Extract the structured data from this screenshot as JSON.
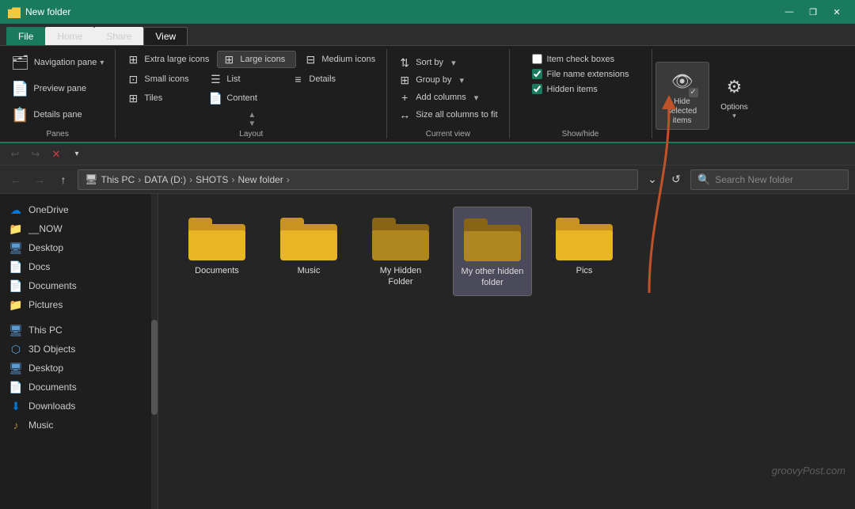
{
  "titlebar": {
    "title": "New folder",
    "min": "—",
    "restore": "❐",
    "close": "✕"
  },
  "tabs": {
    "file": "File",
    "home": "Home",
    "share": "Share",
    "view": "View"
  },
  "ribbon": {
    "panes": {
      "label": "Panes",
      "navigation": "Navigation pane",
      "preview": "Preview pane",
      "details": "Details pane"
    },
    "layout": {
      "label": "Layout",
      "extra_large": "Extra large icons",
      "large": "Large icons",
      "medium": "Medium icons",
      "small": "Small icons",
      "list": "List",
      "details": "Details",
      "tiles": "Tiles",
      "content": "Content"
    },
    "current_view": {
      "label": "Current view",
      "sort": "Sort by",
      "group": "Group by",
      "add_columns": "Add columns",
      "size_columns": "Size all columns to fit"
    },
    "show_hide": {
      "label": "Show/hide",
      "item_checkboxes": "Item check boxes",
      "file_extensions": "File name extensions",
      "hidden_items": "Hidden items",
      "hide_selected": "Hide selected items",
      "options": "Options"
    }
  },
  "quickaccess": {
    "undo": "↩",
    "redo": "↪",
    "delete": "✕",
    "dropdown": "▾"
  },
  "addressbar": {
    "back": "←",
    "forward": "→",
    "up": "↑",
    "path": {
      "thispc": "This PC",
      "sep1": ">",
      "data": "DATA (D:)",
      "sep2": ">",
      "shots": "SHOTS",
      "sep3": ">",
      "folder": "New folder",
      "sep4": ">"
    },
    "search_placeholder": "Search New folder",
    "refresh": "↺",
    "dropdown": "⌄"
  },
  "sidebar": {
    "onedrive": "OneDrive",
    "now": "__NOW",
    "desktop1": "Desktop",
    "docs": "Docs",
    "documents": "Documents",
    "pictures": "Pictures",
    "thispc_label": "This PC",
    "objects3d": "3D Objects",
    "desktop2": "Desktop",
    "documents2": "Documents",
    "downloads": "Downloads",
    "music": "Music"
  },
  "folders": [
    {
      "name": "Documents",
      "hidden": false,
      "selected": false
    },
    {
      "name": "Music",
      "hidden": false,
      "selected": false
    },
    {
      "name": "My Hidden Folder",
      "hidden": true,
      "selected": false
    },
    {
      "name": "My other hidden folder",
      "hidden": true,
      "selected": true
    },
    {
      "name": "Pics",
      "hidden": false,
      "selected": false
    }
  ],
  "watermark": "groovyPost.com",
  "checkboxes": {
    "item_checkboxes": false,
    "file_extensions": true,
    "hidden_items": true
  }
}
